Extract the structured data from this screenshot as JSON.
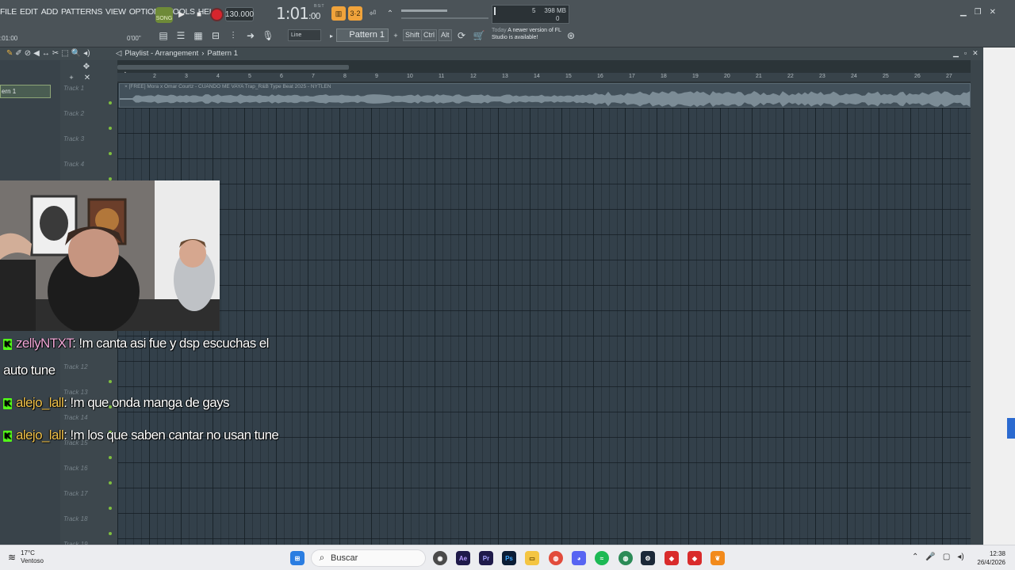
{
  "menu": [
    "FILE",
    "EDIT",
    "ADD",
    "PATTERNS",
    "VIEW",
    "OPTIONS",
    "TOOLS",
    "HELP"
  ],
  "transport": {
    "song_label": "SONG",
    "tempo": "130.000",
    "time_main": "1:01",
    "time_sub": "00",
    "time_sup": "B:S:T"
  },
  "cpu": {
    "value1": "5",
    "memory": "398 MB",
    "value2": "0"
  },
  "toolbar": {
    "snap": "Line",
    "pattern": "Pattern 1",
    "shift": "Shift",
    "ctrl": "Ctrl",
    "alt": "Alt"
  },
  "hint": {
    "today": "Today",
    "message": "A newer version of FL Studio is available!"
  },
  "row2": {
    "left_time": ":01:00",
    "right_time": "0'00\""
  },
  "playlist": {
    "title": "Playlist - Arrangement",
    "separator": "›",
    "pattern": "Pattern 1",
    "picker_selected": "ern 1",
    "clip_title": "× [FREE] Mora x Omar Courtz - CUANDO ME VAYA  Trap_R&B Type Beat 2025 - NYTLEN",
    "ruler": [
      "2",
      "3",
      "4",
      "5",
      "6",
      "7",
      "8",
      "9",
      "10",
      "11",
      "12",
      "13",
      "14",
      "15",
      "16",
      "17",
      "18",
      "19",
      "20",
      "21",
      "22",
      "23",
      "24",
      "25",
      "26",
      "27"
    ],
    "tracks": [
      "Track 1",
      "Track 2",
      "Track 3",
      "Track 4",
      "Track 12",
      "Track 13",
      "Track 14",
      "Track 15",
      "Track 16",
      "Track 17",
      "Track 18",
      "Track 19"
    ]
  },
  "chat": [
    {
      "badge": "K",
      "user": "zellyNTXT",
      "message": ": !m canta asi fue y dsp escuchas el"
    },
    {
      "continuation": "auto tune"
    },
    {
      "badge": "K",
      "user": "alejo_lall",
      "message": ": !m que onda manga de gays"
    },
    {
      "badge": "K",
      "user": "alejo_lall",
      "message": ": !m los que saben cantar no usan tune"
    }
  ],
  "taskbar": {
    "temperature": "17°C",
    "weather": "Ventoso",
    "search_placeholder": "Buscar",
    "apps": [
      "Ae",
      "Pr",
      "Ps"
    ],
    "time": "12:38",
    "date": "26/4/2026"
  },
  "colors": {
    "accent_orange": "#f0a33b",
    "record_red": "#d6252d",
    "kick_green": "#53fc18",
    "user1": "#f2a7d7",
    "user2": "#f2c34a"
  }
}
